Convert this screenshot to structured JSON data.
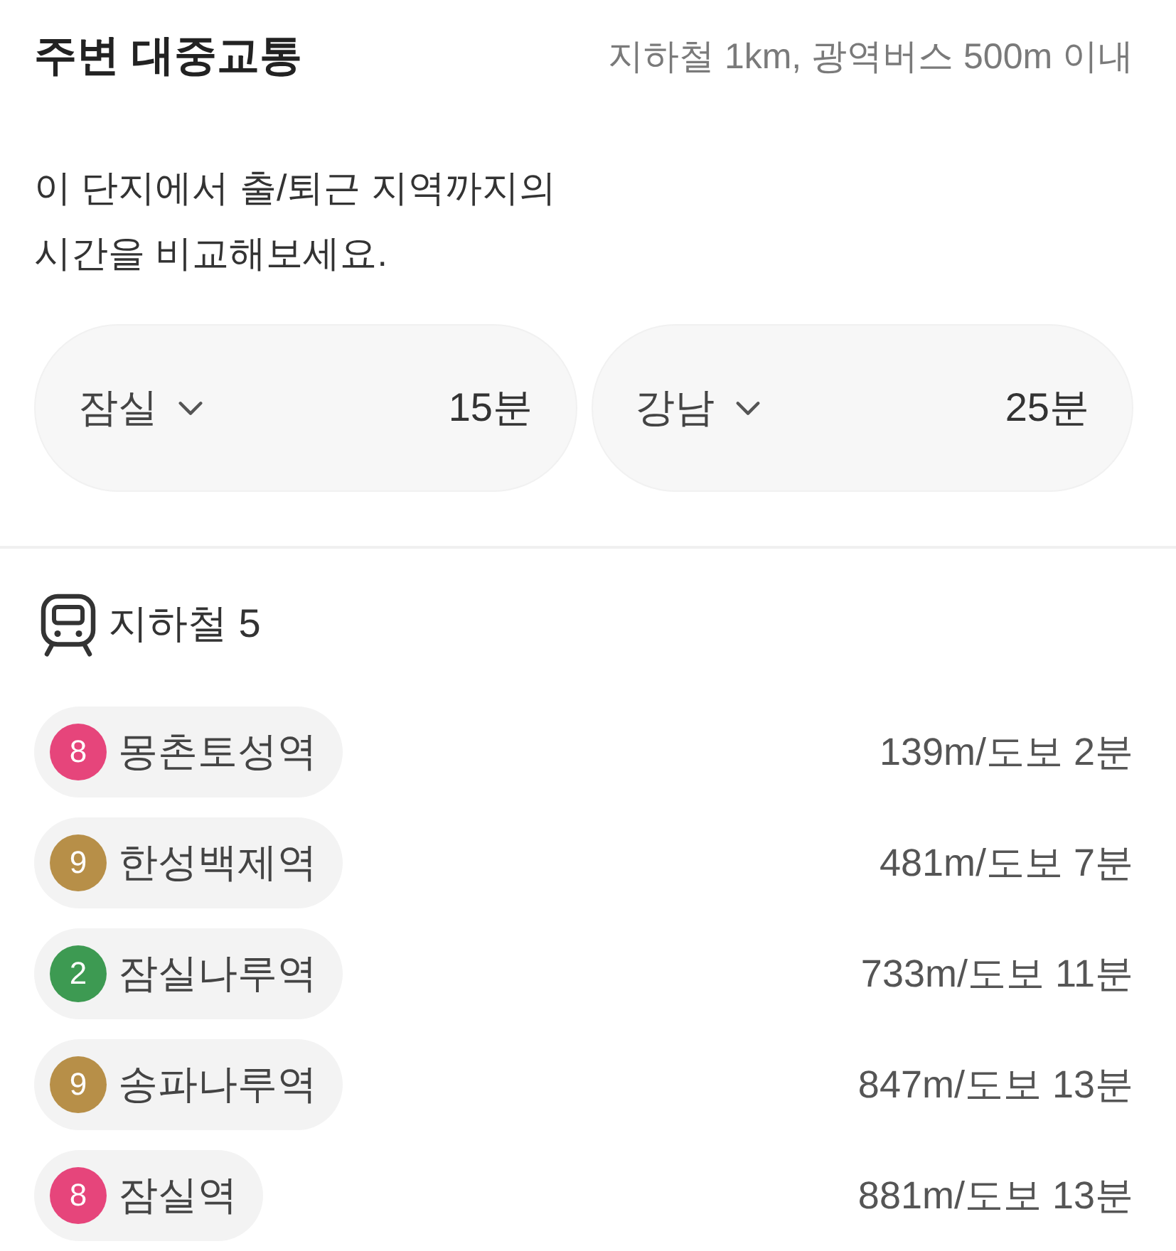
{
  "section": {
    "title": "주변 대중교통",
    "criteria": "지하철 1km, 광역버스 500m 이내",
    "description": "이 단지에서 출/퇴근 지역까지의\n시간을 비교해보세요."
  },
  "commute": [
    {
      "area": "잠실",
      "time": "15분"
    },
    {
      "area": "강남",
      "time": "25분"
    }
  ],
  "transit": {
    "heading": "지하철 5"
  },
  "stations": [
    {
      "line": "8",
      "color": "#e6457b",
      "name": "몽촌토성역",
      "distance": "139m/도보 2분"
    },
    {
      "line": "9",
      "color": "#b78f48",
      "name": "한성백제역",
      "distance": "481m/도보 7분"
    },
    {
      "line": "2",
      "color": "#3d9a52",
      "name": "잠실나루역",
      "distance": "733m/도보 11분"
    },
    {
      "line": "9",
      "color": "#b78f48",
      "name": "송파나루역",
      "distance": "847m/도보 13분"
    },
    {
      "line": "8",
      "color": "#e6457b",
      "name": "잠실역",
      "distance": "881m/도보 13분"
    }
  ]
}
